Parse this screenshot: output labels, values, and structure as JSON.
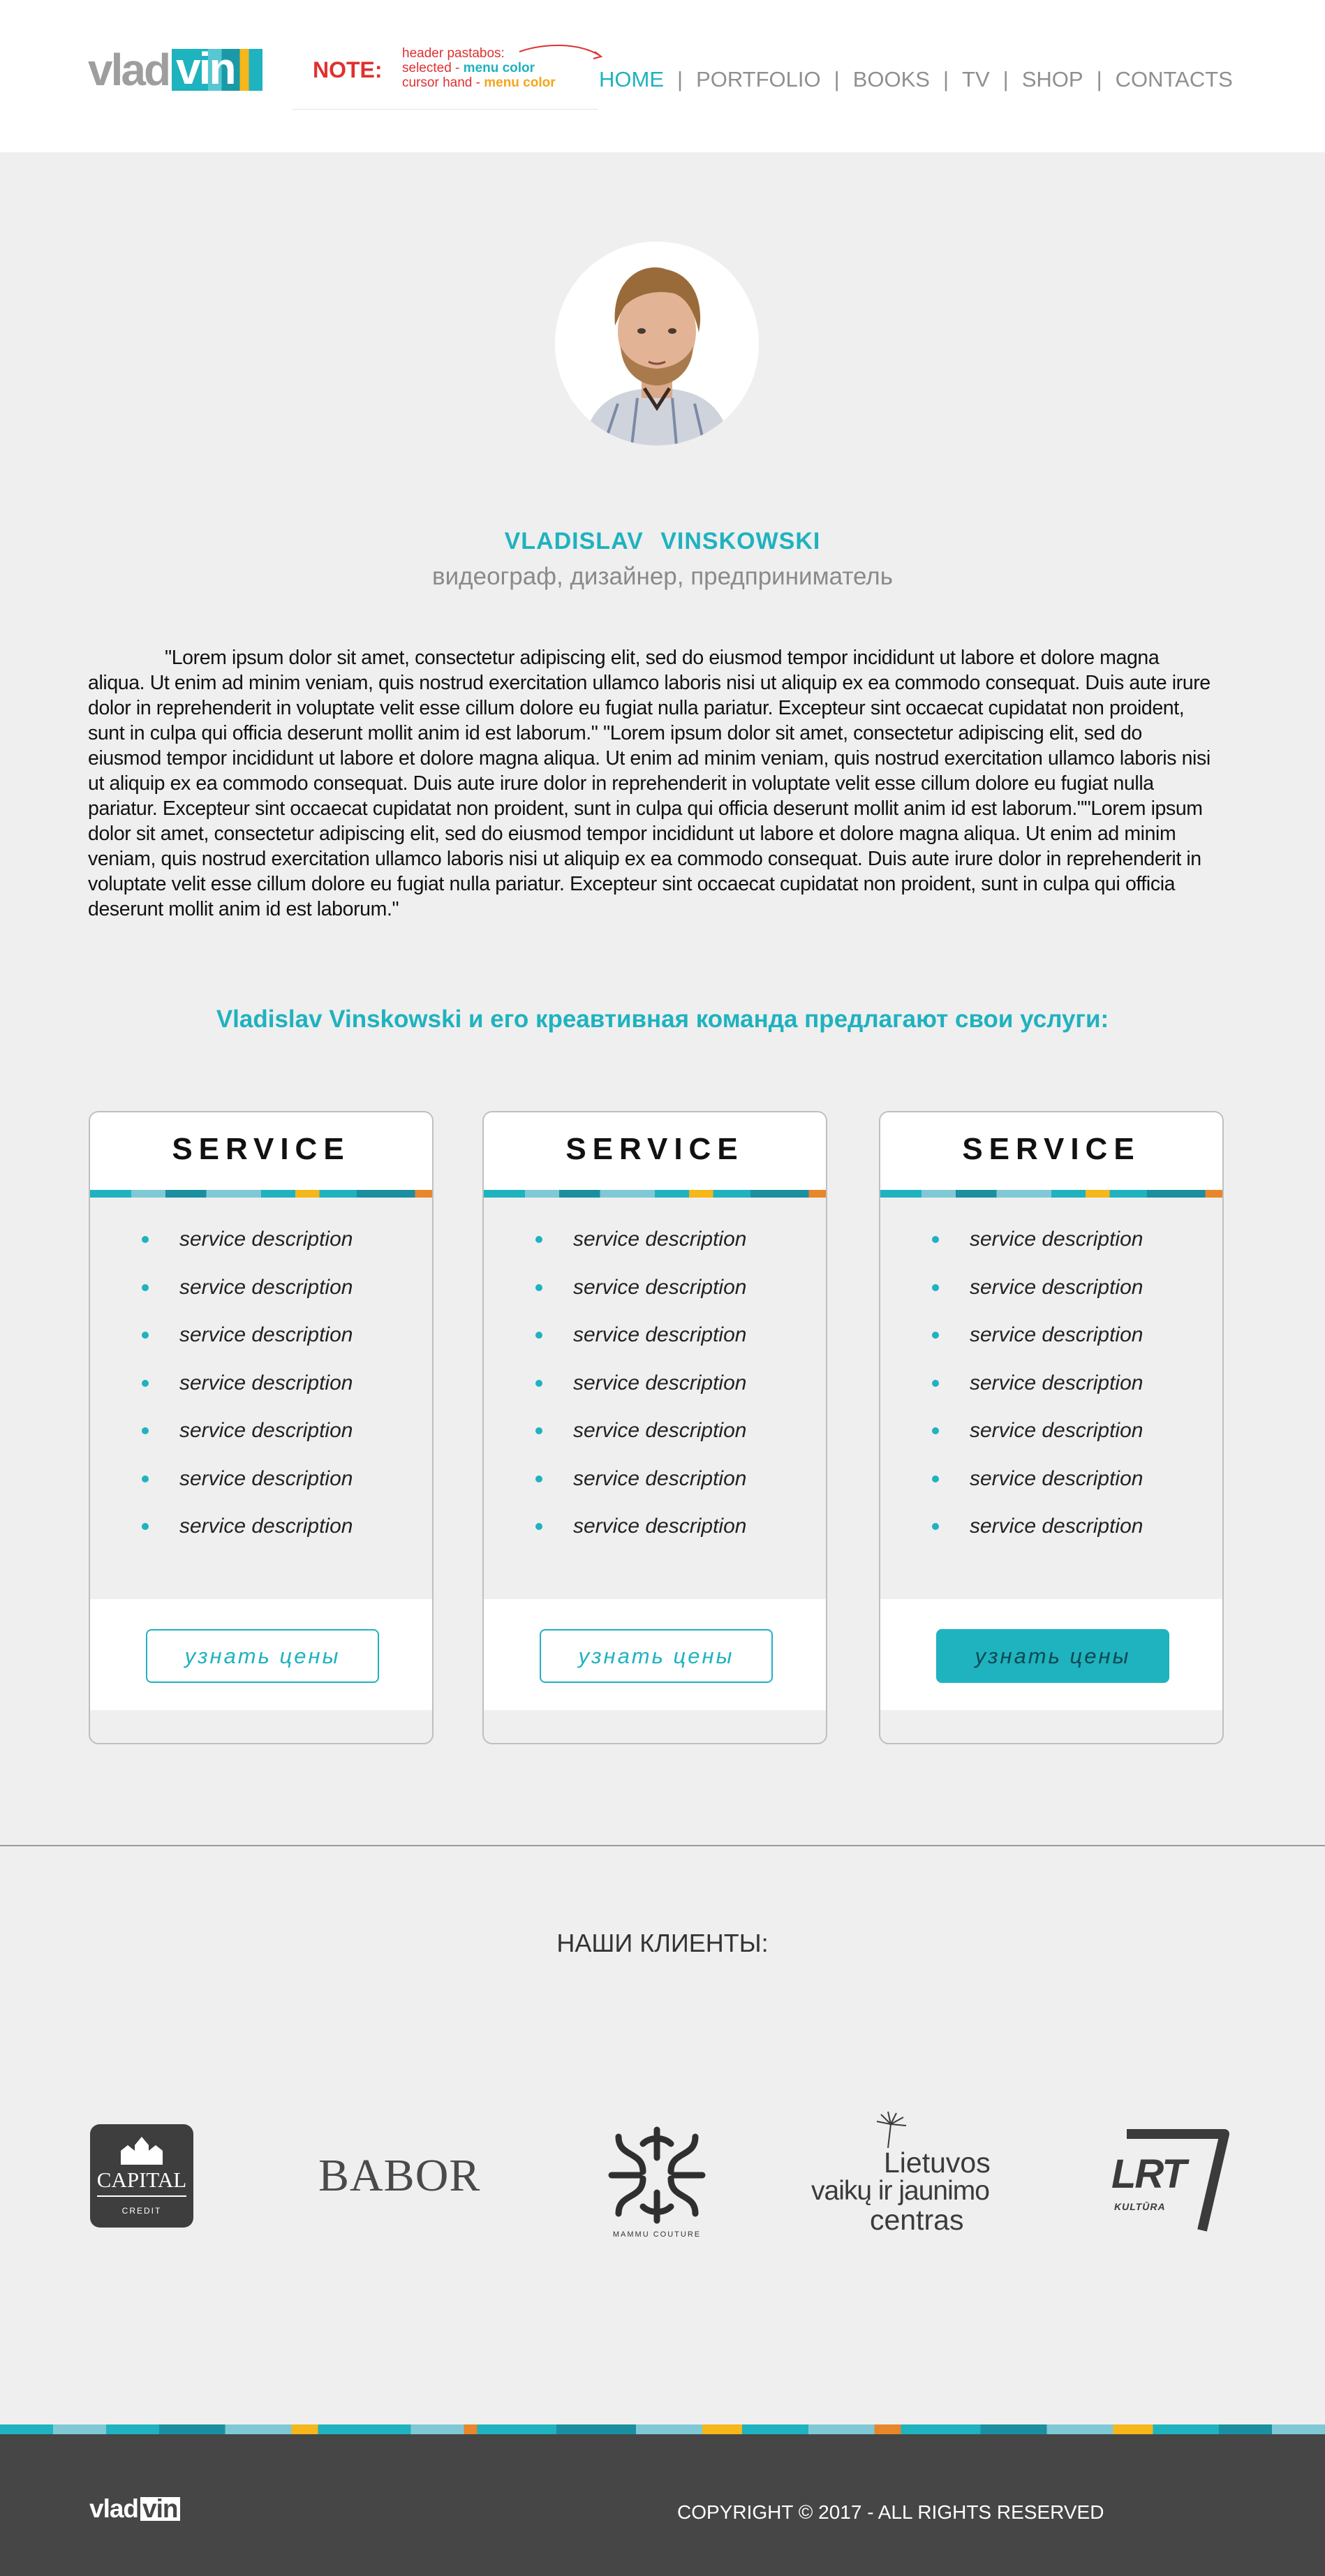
{
  "header": {
    "logo": {
      "part1": "vlad",
      "part2": "vin"
    },
    "note": {
      "title": "NOTE:",
      "line1": "header pastabos:",
      "line2_prefix": "selected - ",
      "line2_accent": "menu color",
      "line3_prefix": "cursor hand - ",
      "line3_accent": "menu color"
    },
    "nav": {
      "home": "HOME",
      "portfolio": "PORTFOLIO",
      "books": "BOOKS",
      "tv": "TV",
      "shop": "SHOP",
      "contacts": "CONTACTS",
      "separator": "|"
    }
  },
  "profile": {
    "name": "VLADISLAV VINSKOWSKI",
    "role": "видеограф, дизайнер, предприниматель",
    "bio": "\"Lorem ipsum dolor sit amet, consectetur adipiscing elit, sed do eiusmod tempor incididunt ut labore et dolore magna aliqua. Ut enim ad minim veniam, quis nostrud exercitation ullamco laboris nisi ut aliquip ex ea commodo consequat. Duis aute irure dolor in reprehenderit in voluptate velit esse cillum dolore eu fugiat nulla pariatur. Excepteur sint occaecat cupidatat non proident, sunt in culpa qui officia deserunt mollit anim id est laborum.\" \"Lorem ipsum dolor sit amet, consectetur adipiscing elit, sed do eiusmod tempor incididunt ut labore et dolore magna aliqua. Ut enim ad minim veniam, quis nostrud exercitation ullamco laboris nisi ut aliquip ex ea commodo consequat. Duis aute irure dolor in reprehenderit in voluptate velit esse cillum dolore eu fugiat nulla pariatur. Excepteur sint occaecat cupidatat non proident, sunt in culpa qui officia deserunt mollit anim id est laborum.\"\"Lorem ipsum dolor sit amet, consectetur adipiscing elit, sed do eiusmod tempor incididunt ut labore et dolore magna aliqua. Ut enim ad minim veniam, quis nostrud exercitation ullamco laboris nisi ut aliquip ex ea commodo consequat. Duis aute irure dolor in reprehenderit in voluptate velit esse cillum dolore eu fugiat nulla pariatur. Excepteur sint occaecat cupidatat non proident, sunt in culpa qui officia deserunt mollit anim id est laborum.\""
  },
  "services": {
    "title": "Vladislav Vinskowski и его креавтивная команда предлагают свои услуги:",
    "cards": [
      {
        "title": "SERVICE",
        "items": [
          "service description",
          "service description",
          "service description",
          "service description",
          "service description",
          "service description",
          "service description"
        ],
        "button": "узнать цены"
      },
      {
        "title": "SERVICE",
        "items": [
          "service description",
          "service description",
          "service description",
          "service description",
          "service description",
          "service description",
          "service description"
        ],
        "button": "узнать цены"
      },
      {
        "title": "SERVICE",
        "items": [
          "service description",
          "service description",
          "service description",
          "service description",
          "service description",
          "service description",
          "service description"
        ],
        "button": "узнать цены"
      }
    ]
  },
  "clients": {
    "title": "НАШИ КЛИЕНТЫ:",
    "capital": {
      "name": "CAPITAL",
      "sub": "CREDIT"
    },
    "babor": "BABOR",
    "mammu": "MAMMU COUTURE",
    "lvjc": {
      "line1": "Lietuvos",
      "line2": "vaikų ir jaunimo",
      "line3": "centras"
    },
    "lrt": {
      "name": "LRT",
      "sub": "KULTŪRA"
    }
  },
  "footer": {
    "logo": {
      "part1": "vlad",
      "part2": "vin"
    },
    "copyright": "COPYRIGHT © 2017 - ALL RIGHTS RESERVED"
  },
  "colors": {
    "accent": "#1fb2bf",
    "note_red": "#e03030",
    "note_yellow": "#f5a51a",
    "footer_bg": "#464646",
    "page_bg": "#efefef"
  }
}
